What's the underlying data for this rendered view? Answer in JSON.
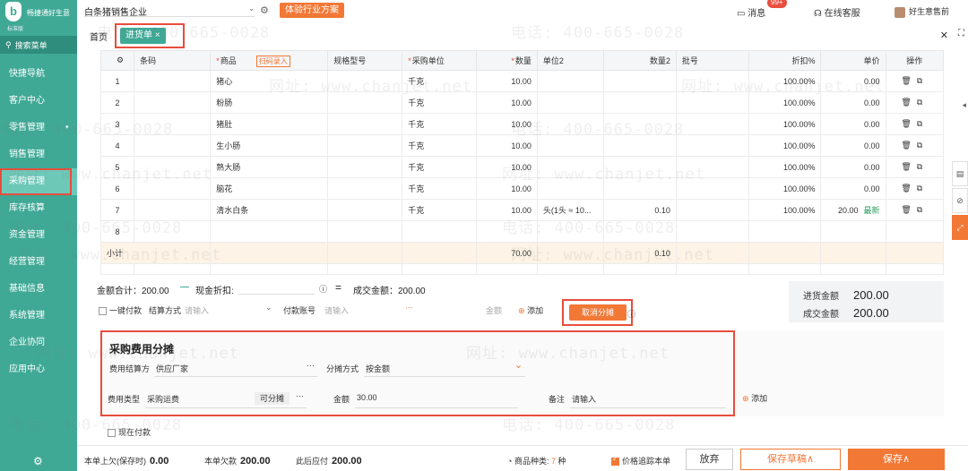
{
  "sidebar": {
    "logo_name": "畅捷通好生意",
    "edition": "标准版",
    "search_label": "搜索菜单",
    "items": [
      {
        "label": "快捷导航",
        "active": false
      },
      {
        "label": "客户中心",
        "active": false
      },
      {
        "label": "零售管理",
        "active": false,
        "caret": "▾"
      },
      {
        "label": "销售管理",
        "active": false
      },
      {
        "label": "采购管理",
        "active": true
      },
      {
        "label": "库存核算",
        "active": false
      },
      {
        "label": "资金管理",
        "active": false
      },
      {
        "label": "经营管理",
        "active": false
      },
      {
        "label": "基础信息",
        "active": false
      },
      {
        "label": "系统管理",
        "active": false
      },
      {
        "label": "企业协同",
        "active": false
      },
      {
        "label": "应用中心",
        "active": false
      }
    ]
  },
  "topbar": {
    "company": "白条猪销售企业",
    "trial": "体验行业方案",
    "messages": "消息",
    "message_badge": "99+",
    "service": "在线客服",
    "user": "好生意售前"
  },
  "tabs": {
    "home": "首页",
    "active": "进货单"
  },
  "table": {
    "headers": [
      "条码",
      "商品",
      "规格型号",
      "采购单位",
      "数量",
      "单位2",
      "数量2",
      "批号",
      "折扣%",
      "单价",
      "操作"
    ],
    "scan_label": "扫码录入",
    "rows": [
      {
        "no": "1",
        "name": "猪心",
        "unit": "千克",
        "qty": "10.00",
        "unit2": "",
        "qty2": "",
        "disc": "100.00%",
        "price": "0.00",
        "latest": ""
      },
      {
        "no": "2",
        "name": "粉肠",
        "unit": "千克",
        "qty": "10.00",
        "unit2": "",
        "qty2": "",
        "disc": "100.00%",
        "price": "0.00",
        "latest": ""
      },
      {
        "no": "3",
        "name": "猪肚",
        "unit": "千克",
        "qty": "10.00",
        "unit2": "",
        "qty2": "",
        "disc": "100.00%",
        "price": "0.00",
        "latest": ""
      },
      {
        "no": "4",
        "name": "生小肠",
        "unit": "千克",
        "qty": "10.00",
        "unit2": "",
        "qty2": "",
        "disc": "100.00%",
        "price": "0.00",
        "latest": ""
      },
      {
        "no": "5",
        "name": "熟大肠",
        "unit": "千克",
        "qty": "10.00",
        "unit2": "",
        "qty2": "",
        "disc": "100.00%",
        "price": "0.00",
        "latest": ""
      },
      {
        "no": "6",
        "name": "脑花",
        "unit": "千克",
        "qty": "10.00",
        "unit2": "",
        "qty2": "",
        "disc": "100.00%",
        "price": "0.00",
        "latest": ""
      },
      {
        "no": "7",
        "name": "清水白条",
        "unit": "千克",
        "qty": "10.00",
        "unit2": "头(1头 ≈ 10...",
        "qty2": "0.10",
        "disc": "100.00%",
        "price": "20.00",
        "latest": "最新"
      },
      {
        "no": "8",
        "name": "",
        "unit": "",
        "qty": "",
        "unit2": "",
        "qty2": "",
        "disc": "",
        "price": "",
        "latest": ""
      }
    ],
    "subtotal_label": "小计",
    "subtotal_qty": "70.00",
    "subtotal_qty2": "0.10"
  },
  "summary": {
    "amount_total": "金额合计：200.00",
    "cash_discount": "现金折扣:",
    "deal_amount": "成交金额：200.00",
    "one_click_pay": "一键付款",
    "settle_method_label": "结算方式",
    "settle_method_ph": "请输入",
    "pay_account_label": "付款账号",
    "pay_account_ph": "请输入",
    "amount_label": "金额",
    "add_label": "添加",
    "cancel_alloc": "取消分摊",
    "purchase_amount_label": "进货金额",
    "purchase_amount": "200.00",
    "deal_amount_label": "成交金额",
    "deal_amount_value": "200.00"
  },
  "allocation": {
    "title": "采购费用分摊",
    "settle_party_label": "费用结算方",
    "settle_party": "供应厂家",
    "method_label": "分摊方式",
    "method": "按金额",
    "fee_type_label": "费用类型",
    "fee_type": "采购运费",
    "allocatable_tag": "可分摊",
    "amount_label": "金额",
    "amount": "30.00",
    "note_label": "备注",
    "note_ph": "请输入",
    "add_label": "添加"
  },
  "pay_now": "现在付款",
  "bottom": {
    "unpaid_label": "本单上欠(保存时)",
    "unpaid": "0.00",
    "owed_label": "本单欠款",
    "owed": "200.00",
    "after_label": "此后应付",
    "after": "200.00",
    "kinds_label": "商品种类:",
    "kinds": "7",
    "kinds_unit": "种",
    "trace_label": "价格追踪本单",
    "discard": "放弃",
    "save_draft": "保存草稿∧",
    "save": "保存∧"
  },
  "watermark": {
    "phone": "电话: 400-665-0028",
    "site": "网址: www.chanjet.net"
  },
  "colors": {
    "brand_green": "#3fa996",
    "accent_orange": "#f27836",
    "highlight_red": "#e84d3d"
  }
}
